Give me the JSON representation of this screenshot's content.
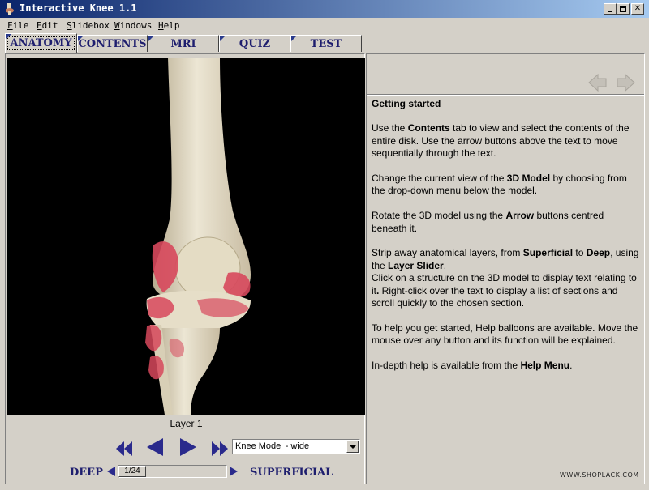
{
  "window": {
    "title": "Interactive Knee 1.1"
  },
  "menu": [
    {
      "label_ul": "F",
      "label_rest": "ile"
    },
    {
      "label_ul": "E",
      "label_rest": "dit"
    },
    {
      "label_ul": "S",
      "label_rest": "lidebox"
    },
    {
      "label_ul": "W",
      "label_rest": "indows"
    },
    {
      "label_ul": "H",
      "label_rest": "elp"
    }
  ],
  "tabs": [
    {
      "label": "ANATOMY",
      "active": true
    },
    {
      "label": "CONTENTS",
      "active": false
    },
    {
      "label": "MRI",
      "active": false
    },
    {
      "label": "QUIZ",
      "active": false
    },
    {
      "label": "TEST",
      "active": false
    }
  ],
  "viewer": {
    "layer_label": "Layer 1",
    "model_select": "Knee Model - wide",
    "slider_position": "1/24",
    "slider_level": 0.04,
    "deep_label": "DEEP",
    "superficial_label": "SUPERFICIAL"
  },
  "info": {
    "heading": "Getting started",
    "paragraphs": [
      [
        {
          "t": "Use the "
        },
        {
          "t": "Contents",
          "b": true
        },
        {
          "t": " tab to view and select the contents of the entire disk.  Use the arrow buttons above the text to move sequentially through the text."
        }
      ],
      [
        {
          "t": "Change the current view of the "
        },
        {
          "t": "3D Model",
          "b": true
        },
        {
          "t": " by choosing from the drop-down menu below the model."
        }
      ],
      [
        {
          "t": "Rotate the 3D model using the "
        },
        {
          "t": "Arrow",
          "b": true
        },
        {
          "t": " buttons centred beneath it."
        }
      ],
      [
        {
          "t": "Strip away anatomical layers, from "
        },
        {
          "t": "Superficial",
          "b": true
        },
        {
          "t": " to "
        },
        {
          "t": "Deep",
          "b": true
        },
        {
          "t": ", using the "
        },
        {
          "t": "Layer Slider",
          "b": true
        },
        {
          "t": ".\nClick on a structure on the 3D model to display text relating to it"
        },
        {
          "t": ".",
          "b": true
        },
        {
          "t": " Right-click over the text to display a list of sections and scroll quickly to the chosen section."
        }
      ],
      [
        {
          "t": "To help you get started, Help balloons are available. Move the mouse over any button and its function will be explained."
        }
      ],
      [
        {
          "t": "In-depth help is available from the "
        },
        {
          "t": "Help Menu",
          "b": true
        },
        {
          "t": "."
        }
      ]
    ]
  },
  "watermark": "WWW.SHOPLACK.COM",
  "colors": {
    "accent": "#2a2a8c",
    "tab_text": "#1e1e6e",
    "bone": "#e8e0cc",
    "tissue": "#d23c50"
  }
}
